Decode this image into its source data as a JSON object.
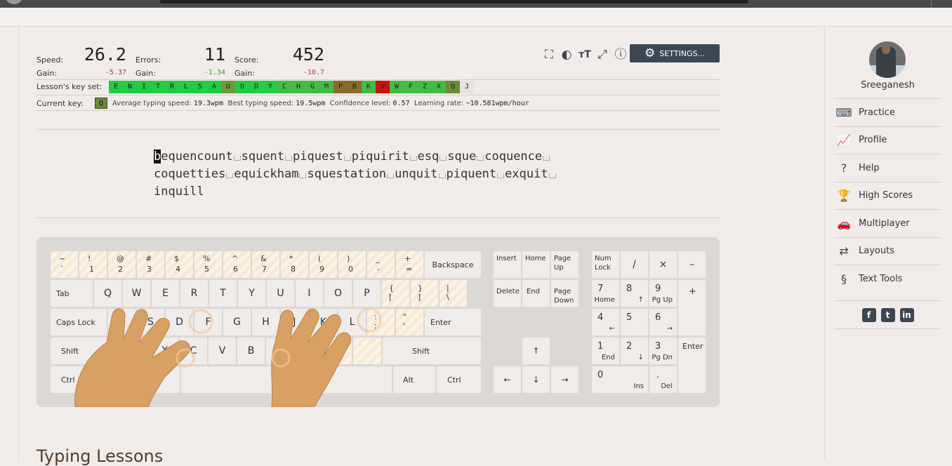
{
  "metrics": {
    "speed": {
      "label": "Speed:",
      "value": "26.2",
      "gain_label": "Gain:",
      "gain": "-5.37"
    },
    "errors": {
      "label": "Errors:",
      "value": "11",
      "gain_label": "Gain:",
      "gain": "-1.34"
    },
    "score": {
      "label": "Score:",
      "value": "452",
      "gain_label": "Gain:",
      "gain": "-10.7"
    }
  },
  "toolbar": {
    "icons": [
      "zoom-frame-icon",
      "theme-icon",
      "font-size-icon",
      "fullscreen-icon",
      "help-icon"
    ],
    "settings_label": "SETTINGS..."
  },
  "keyset": {
    "label": "Lesson's key set:",
    "keys": [
      {
        "k": "E",
        "color": "#22cc44"
      },
      {
        "k": "N",
        "color": "#22cc44"
      },
      {
        "k": "I",
        "color": "#22cc44"
      },
      {
        "k": "T",
        "color": "#22cc44"
      },
      {
        "k": "R",
        "color": "#22cc44"
      },
      {
        "k": "L",
        "color": "#22cc44"
      },
      {
        "k": "S",
        "color": "#22cc44"
      },
      {
        "k": "A",
        "color": "#22cc44"
      },
      {
        "k": "U",
        "color": "#6c9a3a"
      },
      {
        "k": "O",
        "color": "#22cc44"
      },
      {
        "k": "D",
        "color": "#22cc44"
      },
      {
        "k": "Y",
        "color": "#22cc44"
      },
      {
        "k": "C",
        "color": "#44bb44"
      },
      {
        "k": "H",
        "color": "#44bb44"
      },
      {
        "k": "G",
        "color": "#44bb44"
      },
      {
        "k": "M",
        "color": "#44bb44"
      },
      {
        "k": "P",
        "color": "#8a6a2a"
      },
      {
        "k": "B",
        "color": "#8a6a2a"
      },
      {
        "k": "K",
        "color": "#44bb44"
      },
      {
        "k": "V",
        "color": "#cc1111"
      },
      {
        "k": "W",
        "color": "#44bb44"
      },
      {
        "k": "F",
        "color": "#44bb44"
      },
      {
        "k": "Z",
        "color": "#44bb44"
      },
      {
        "k": "X",
        "color": "#44bb44"
      },
      {
        "k": "Q",
        "color": "#6c8a3a"
      },
      {
        "k": "J",
        "color": "#e6e2df"
      }
    ]
  },
  "current": {
    "label": "Current key:",
    "key": "Q",
    "avg_label": "Average typing speed:",
    "avg_value": "19.3wpm",
    "best_label": "Best typing speed:",
    "best_value": "19.5wpm",
    "confidence_label": "Confidence level:",
    "confidence_value": "0.57",
    "rate_label": "Learning rate:",
    "rate_value": "~10.581wpm/hour"
  },
  "lesson_text": {
    "cursor_char": "b",
    "line1": [
      "equencount",
      "squent",
      "piquest",
      "piquirit",
      "esq",
      "sque",
      "coquence"
    ],
    "line2": [
      "coquetties",
      "equickham",
      "squestation",
      "unquit",
      "piquent",
      "exquit"
    ],
    "line3": [
      "inquill"
    ]
  },
  "keyboard": {
    "row1": [
      [
        "~",
        "`"
      ],
      [
        "!",
        "1"
      ],
      [
        "@",
        "2"
      ],
      [
        "#",
        "3"
      ],
      [
        "$",
        "4"
      ],
      [
        "%",
        "5"
      ],
      [
        "^",
        "6"
      ],
      [
        "&",
        "7"
      ],
      [
        "*",
        "8"
      ],
      [
        "(",
        "9"
      ],
      [
        ")",
        "0"
      ],
      [
        "_",
        "-"
      ],
      [
        "+",
        "="
      ]
    ],
    "backspace": "Backspace",
    "tab": "Tab",
    "row2": [
      "Q",
      "W",
      "E",
      "R",
      "T",
      "Y",
      "U",
      "I",
      "O",
      "P"
    ],
    "row2_sym": [
      [
        "{",
        "["
      ],
      [
        "}",
        "]"
      ],
      [
        "|",
        "\\"
      ]
    ],
    "caps": "Caps Lock",
    "row3": [
      "A",
      "S",
      "D",
      "F",
      "G",
      "H",
      "J",
      "K",
      "L"
    ],
    "row3_sym": [
      [
        ":",
        ";"
      ],
      [
        "\"",
        "'"
      ]
    ],
    "enter": "Enter",
    "shift_l": "Shift",
    "row4": [
      "Z",
      "X",
      "C",
      "V",
      "B",
      "N",
      "M"
    ],
    "shift_r": "Shift",
    "ctrl_l": "Ctrl",
    "alt_r": "Alt",
    "ctrl_r": "Ctrl",
    "nav": {
      "insert": "Insert",
      "home": "Home",
      "pgup": "Page Up",
      "delete": "Delete",
      "end": "End",
      "pgdn": "Page Down"
    },
    "arrows": {
      "up": "↑",
      "left": "←",
      "down": "↓",
      "right": "→"
    },
    "numpad": {
      "numlock": "Num Lock",
      "div": "/",
      "mul": "×",
      "minus": "–",
      "plus": "+",
      "enter": "Enter",
      "n7": "7",
      "n7s": "Home",
      "n8": "8",
      "n8s": "↑",
      "n9": "9",
      "n9s": "Pg Up",
      "n4": "4",
      "n4s": "←",
      "n5": "5",
      "n6": "6",
      "n6s": "→",
      "n1": "1",
      "n1s": "End",
      "n2": "2",
      "n2s": "↓",
      "n3": "3",
      "n3s": "Pg Dn",
      "n0": "0",
      "n0s": "Ins",
      "dot": ".",
      "dots": "Del"
    }
  },
  "sidebar": {
    "username": "Sreeganesh",
    "items": [
      {
        "label": "Practice",
        "icon": "keyboard-icon",
        "glyph": "⌨"
      },
      {
        "label": "Profile",
        "icon": "chart-icon",
        "glyph": "📈"
      },
      {
        "label": "Help",
        "icon": "help-icon",
        "glyph": "?"
      },
      {
        "label": "High Scores",
        "icon": "trophy-icon",
        "glyph": "🏆"
      },
      {
        "label": "Multiplayer",
        "icon": "car-icon",
        "glyph": "🚗"
      },
      {
        "label": "Layouts",
        "icon": "layouts-icon",
        "glyph": "⇄"
      },
      {
        "label": "Text Tools",
        "icon": "section-icon",
        "glyph": "§"
      }
    ],
    "social": [
      {
        "icon": "facebook-icon",
        "glyph": "f"
      },
      {
        "icon": "twitter-icon",
        "glyph": "t"
      },
      {
        "icon": "linkedin-icon",
        "glyph": "in"
      }
    ]
  },
  "lessons_title": "Typing Lessons"
}
